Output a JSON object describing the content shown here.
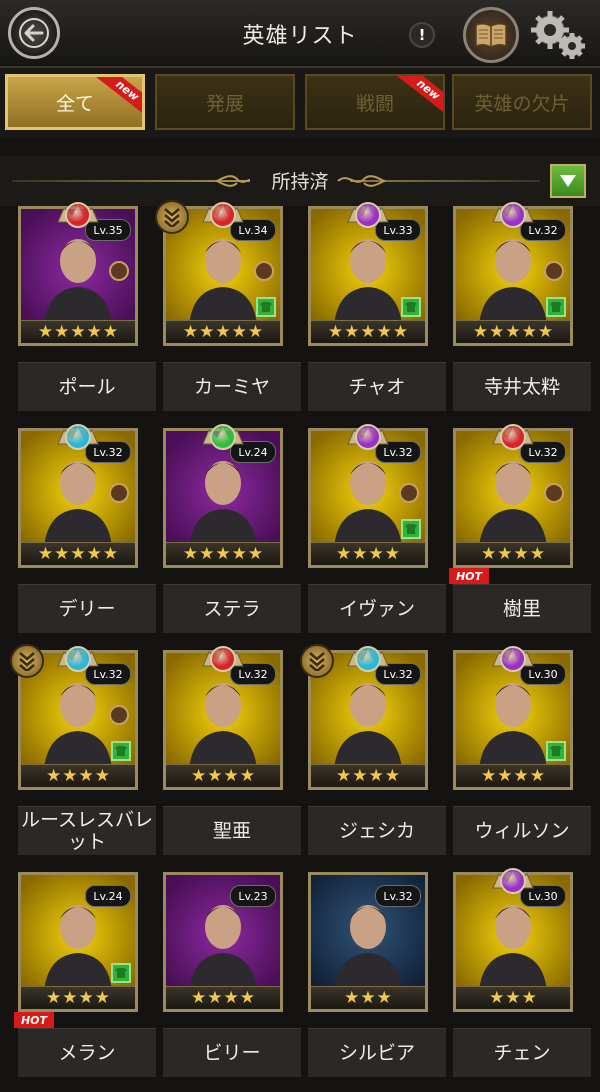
{
  "header": {
    "title": "英雄リスト",
    "info_label": "!"
  },
  "tabs": [
    {
      "label": "全て",
      "active": true,
      "badge": "new"
    },
    {
      "label": "発展",
      "active": false,
      "badge": ""
    },
    {
      "label": "戦闘",
      "active": false,
      "badge": "new"
    },
    {
      "label": "英雄の欠片",
      "active": false,
      "badge": ""
    }
  ],
  "section": {
    "title": "所持済"
  },
  "heroes": [
    {
      "name": "ポール",
      "level": "Lv.35",
      "stars": 5,
      "bg": "purple",
      "gem": "#d9232b",
      "equip": "none",
      "pet": true,
      "rank": false,
      "hot": false
    },
    {
      "name": "カーミヤ",
      "level": "Lv.34",
      "stars": 5,
      "bg": "yellow",
      "gem": "#d9232b",
      "equip": "green",
      "pet": true,
      "rank": true,
      "hot": false
    },
    {
      "name": "チャオ",
      "level": "Lv.33",
      "stars": 5,
      "bg": "yellow",
      "gem": "#9b2fc9",
      "equip": "green",
      "pet": false,
      "rank": false,
      "hot": false
    },
    {
      "name": "寺井太粋",
      "level": "Lv.32",
      "stars": 5,
      "bg": "yellow",
      "gem": "#9b2fc9",
      "equip": "green",
      "pet": true,
      "rank": false,
      "hot": false
    },
    {
      "name": "デリー",
      "level": "Lv.32",
      "stars": 5,
      "bg": "yellow",
      "gem": "#2bb7d9",
      "equip": "none",
      "pet": true,
      "rank": false,
      "hot": false
    },
    {
      "name": "ステラ",
      "level": "Lv.24",
      "stars": 5,
      "bg": "purple",
      "gem": "#2fbf3f",
      "equip": "none",
      "pet": false,
      "rank": false,
      "hot": false
    },
    {
      "name": "イヴァン",
      "level": "Lv.32",
      "stars": 4,
      "bg": "yellow",
      "gem": "#9b2fc9",
      "equip": "green",
      "pet": true,
      "rank": false,
      "hot": false
    },
    {
      "name": "樹里",
      "level": "Lv.32",
      "stars": 4,
      "bg": "yellow",
      "gem": "#d9232b",
      "equip": "none",
      "pet": true,
      "rank": false,
      "hot": true
    },
    {
      "name": "ルースレスバレット",
      "level": "Lv.32",
      "stars": 4,
      "bg": "yellow",
      "gem": "#2bb7d9",
      "equip": "green",
      "pet": true,
      "rank": true,
      "hot": false
    },
    {
      "name": "聖亜",
      "level": "Lv.32",
      "stars": 4,
      "bg": "yellow",
      "gem": "#d9232b",
      "equip": "none",
      "pet": false,
      "rank": false,
      "hot": false
    },
    {
      "name": "ジェシカ",
      "level": "Lv.32",
      "stars": 4,
      "bg": "yellow",
      "gem": "#2bb7d9",
      "equip": "none",
      "pet": false,
      "rank": true,
      "hot": false
    },
    {
      "name": "ウィルソン",
      "level": "Lv.30",
      "stars": 4,
      "bg": "yellow",
      "gem": "#9b2fc9",
      "equip": "green",
      "pet": false,
      "rank": false,
      "hot": false
    },
    {
      "name": "メラン",
      "level": "Lv.24",
      "stars": 4,
      "bg": "yellow",
      "gem": "",
      "equip": "green",
      "pet": false,
      "rank": false,
      "hot": true
    },
    {
      "name": "ビリー",
      "level": "Lv.23",
      "stars": 4,
      "bg": "purple",
      "gem": "",
      "equip": "none",
      "pet": false,
      "rank": false,
      "hot": false
    },
    {
      "name": "シルビア",
      "level": "Lv.32",
      "stars": 3,
      "bg": "dark",
      "gem": "",
      "equip": "none",
      "pet": false,
      "rank": false,
      "hot": false
    },
    {
      "name": "チェン",
      "level": "Lv.30",
      "stars": 3,
      "bg": "yellow",
      "gem": "#9b2fc9",
      "equip": "none",
      "pet": false,
      "rank": false,
      "hot": false
    }
  ],
  "labels": {
    "hot": "HOT"
  }
}
